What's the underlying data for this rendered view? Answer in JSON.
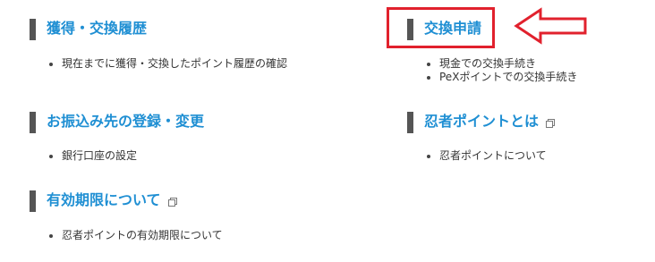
{
  "sections": {
    "history": {
      "title": "獲得・交換履歴",
      "items": [
        "現在までに獲得・交換したポイント履歴の確認"
      ]
    },
    "exchange": {
      "title": "交換申請",
      "items": [
        "現金での交換手続き",
        "PeXポイントでの交換手続き"
      ]
    },
    "bank": {
      "title": "お振込み先の登録・変更",
      "items": [
        "銀行口座の設定"
      ]
    },
    "ninja": {
      "title": "忍者ポイントとは",
      "items": [
        "忍者ポイントについて"
      ]
    },
    "expiry": {
      "title": "有効期限について",
      "items": [
        "忍者ポイントの有効期限について"
      ]
    }
  },
  "colors": {
    "link": "#1f8fd3",
    "bar": "#555555",
    "highlight": "#e1212d"
  },
  "icons": {
    "external": "external-link-icon",
    "annotation": "left-arrow-icon"
  }
}
